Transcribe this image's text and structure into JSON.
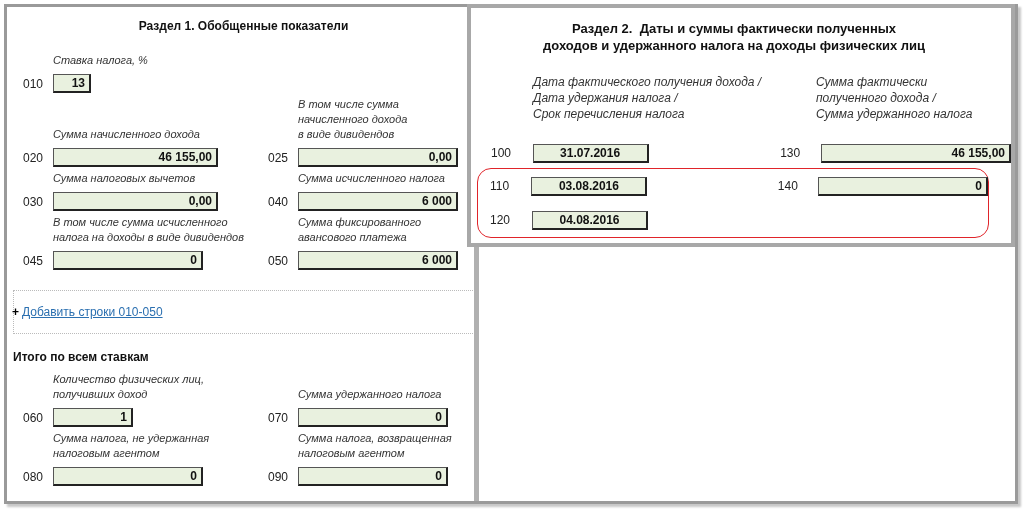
{
  "section1": {
    "title": "Раздел 1. Обобщенные показатели",
    "rows": [
      [
        {
          "label": [
            "Ставка налога, %"
          ],
          "code": "010",
          "value": "13"
        },
        null
      ],
      [
        {
          "label": [
            "Сумма начисленного дохода"
          ],
          "code": "020",
          "value": "46 155,00"
        },
        {
          "label": [
            "В том числе сумма",
            "начисленного дохода",
            "в виде дивидендов"
          ],
          "code": "025",
          "value": "0,00"
        }
      ],
      [
        {
          "label": [
            "Сумма налоговых вычетов"
          ],
          "code": "030",
          "value": "0,00"
        },
        {
          "label": [
            "Сумма исчисленного налога"
          ],
          "code": "040",
          "value": "6 000"
        }
      ],
      [
        {
          "label": [
            "В том числе сумма исчисленного",
            "налога на доходы в виде дивидендов"
          ],
          "code": "045",
          "value": "0"
        },
        {
          "label": [
            "Сумма фиксированного",
            "авансового платежа"
          ],
          "code": "050",
          "value": "6 000"
        }
      ]
    ],
    "add": {
      "icon": "+",
      "link": "Добавить строки 010-050"
    },
    "totals_title": "Итого по всем ставкам",
    "totals": [
      [
        {
          "label": [
            "Количество физических лиц,",
            "получивших доход"
          ],
          "code": "060",
          "value": "1"
        },
        {
          "label": [
            "Сумма удержанного налога"
          ],
          "code": "070",
          "value": "0"
        }
      ],
      [
        {
          "label": [
            "Сумма налога, не удержанная",
            "налоговым агентом"
          ],
          "code": "080",
          "value": "0"
        },
        {
          "label": [
            "Сумма налога, возвращенная",
            "налоговым агентом"
          ],
          "code": "090",
          "value": "0"
        }
      ]
    ]
  },
  "section2": {
    "title": [
      "Раздел 2.  Даты и суммы фактически полученных",
      "доходов и удержанного налога на доходы физических лиц"
    ],
    "headers": [
      [
        "Дата фактического получения дохода /",
        "Дата удержания налога /",
        "Срок перечисления налога"
      ],
      [
        "Сумма фактически",
        "полученного дохода /",
        "Сумма удержанного налога"
      ]
    ],
    "rows": [
      {
        "date_code": "100",
        "date": "31.07.2016",
        "sum_code": "130",
        "sum": "46 155,00",
        "highlighted": false
      },
      {
        "date_code": "110",
        "date": "03.08.2016",
        "sum_code": "140",
        "sum": "0",
        "highlighted": true
      },
      {
        "date_code": "120",
        "date": "04.08.2016",
        "highlighted": true
      }
    ]
  }
}
